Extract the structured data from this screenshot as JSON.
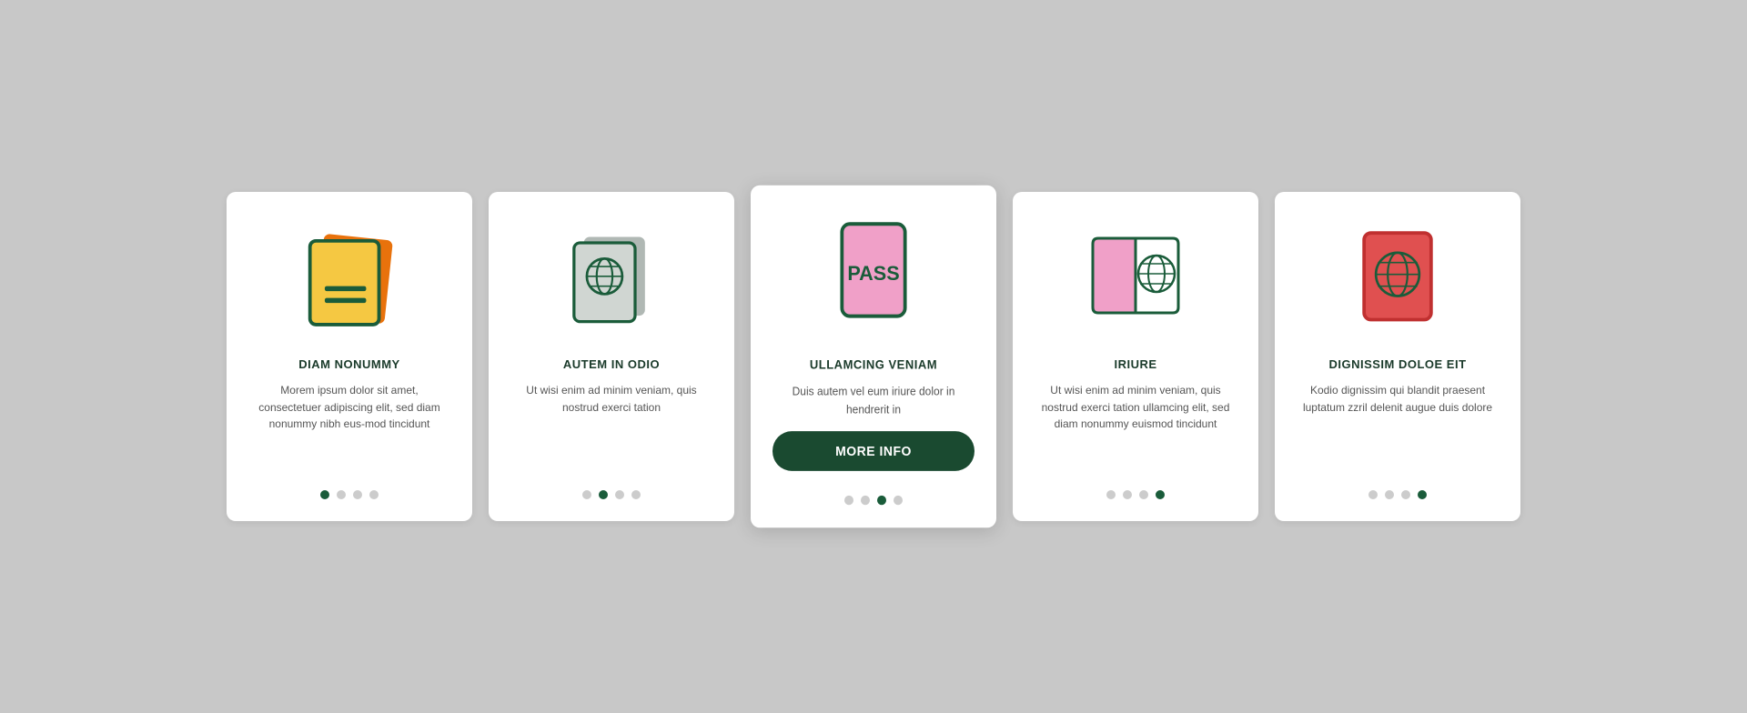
{
  "cards": [
    {
      "id": "card-1",
      "title": "DIAM NONUMMY",
      "text": "Morem ipsum dolor sit amet, consectetuer adipiscing elit, sed diam nonummy nibh eus-mod tincidunt",
      "icon": "documents",
      "dots": [
        true,
        false,
        false,
        false
      ],
      "active": false
    },
    {
      "id": "card-2",
      "title": "AUTEM IN ODIO",
      "text": "Ut wisi enim ad minim veniam, quis nostrud exerci tation",
      "icon": "passport-gray",
      "dots": [
        false,
        true,
        false,
        false
      ],
      "active": false
    },
    {
      "id": "card-3",
      "title": "ULLAMCING VENIAM",
      "text": "Duis autem vel eum iriure dolor in hendrerit in",
      "icon": "passport-pink",
      "dots": [
        false,
        false,
        true,
        false
      ],
      "active": true,
      "button": "MORE INFO"
    },
    {
      "id": "card-4",
      "title": "IRIURE",
      "text": "Ut wisi enim ad minim veniam, quis nostrud exerci tation ullamcing elit, sed diam nonummy euismod tincidunt",
      "icon": "passport-open",
      "dots": [
        false,
        false,
        false,
        true
      ],
      "active": false
    },
    {
      "id": "card-5",
      "title": "DIGNISSIM DOLOE EIT",
      "text": "Kodio dignissim qui blandit praesent luptatum zzril delenit augue duis dolore",
      "icon": "passport-red",
      "dots": [
        false,
        false,
        false,
        true
      ],
      "active": false
    }
  ]
}
